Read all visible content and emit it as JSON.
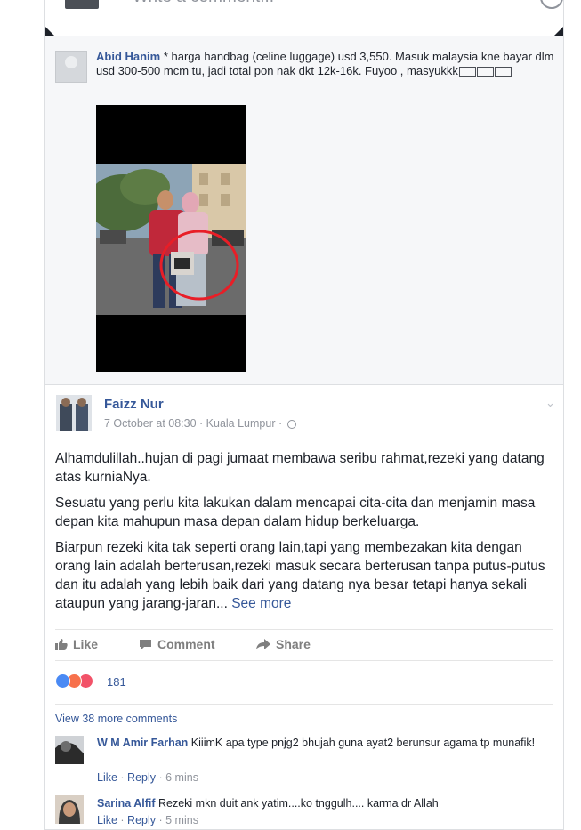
{
  "composer": {
    "placeholder": "Write a comment...",
    "icon": "emoji-icon"
  },
  "embedded_comment": {
    "author": "Abid Hanim",
    "text": " * harga handbag (celine luggage) usd 3,550. Masuk malaysia kne bayar dlm usd 300-500 mcm tu, jadi total pon nak dkt 12k-16k. Fuyoo , masyukkk",
    "photo_description": "couple holding baby with handbag circled in red"
  },
  "post": {
    "author": "Faizz Nur",
    "timestamp": "7 October at 08:30",
    "location": "Kuala Lumpur",
    "separator": " · ",
    "paragraphs": [
      "Alhamdulillah..hujan di pagi jumaat membawa seribu rahmat,rezeki yang datang atas kurniaNya.",
      "Sesuatu yang perlu kita lakukan dalam mencapai cita-cita dan menjamin masa depan kita mahupun masa depan dalam hidup berkeluarga.",
      "Biarpun rezeki kita tak seperti orang lain,tapi yang membezakan kita dengan orang lain adalah berterusan,rezeki masuk secara berterusan tanpa putus-putus dan itu adalah yang lebih baik dari yang datang nya besar tetapi hanya sekali ataupun yang jarang-jaran..."
    ],
    "see_more": "See more",
    "actions": {
      "like": "Like",
      "comment": "Comment",
      "share": "Share"
    },
    "reaction_count": "181",
    "reaction_colors": {
      "like": "#4a8af4",
      "angry": "#f7714c",
      "love": "#f25268"
    },
    "view_more_comments": "View 38 more comments",
    "comments": [
      {
        "author": "W M Amir Farhan",
        "text": " KiiimK apa type pnjg2 bhujah guna ayat2 berunsur agama tp munafik!",
        "like": "Like",
        "reply": "Reply",
        "time": "6 mins"
      },
      {
        "author": "Sarina Alfif",
        "text": " Rezeki mkn duit ank yatim....ko tnggulh.... karma dr Allah",
        "like": "Like",
        "reply": "Reply",
        "time": "5 mins"
      }
    ]
  },
  "colors": {
    "link": "#365899",
    "meta": "#90949c",
    "panel_bg": "#f6f7f9",
    "border": "#dddfe2"
  }
}
